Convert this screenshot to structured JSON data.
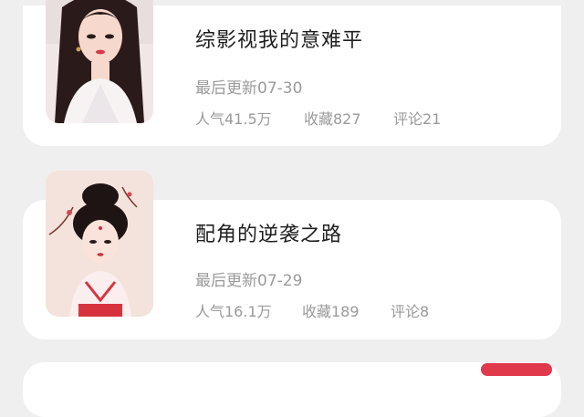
{
  "books": [
    {
      "title": "综影视我的意难平",
      "updated": "最后更新07-30",
      "popularity": "人气41.5万",
      "favorites": "收藏827",
      "comments": "评论21"
    },
    {
      "title": "配角的逆袭之路",
      "updated": "最后更新07-29",
      "popularity": "人气16.1万",
      "favorites": "收藏189",
      "comments": "评论8"
    }
  ],
  "colors": {
    "background": "#efefef",
    "card": "#ffffff",
    "title_text": "#1f1f1f",
    "meta_text": "#9a9a9a",
    "accent_badge": "#e0394b"
  }
}
